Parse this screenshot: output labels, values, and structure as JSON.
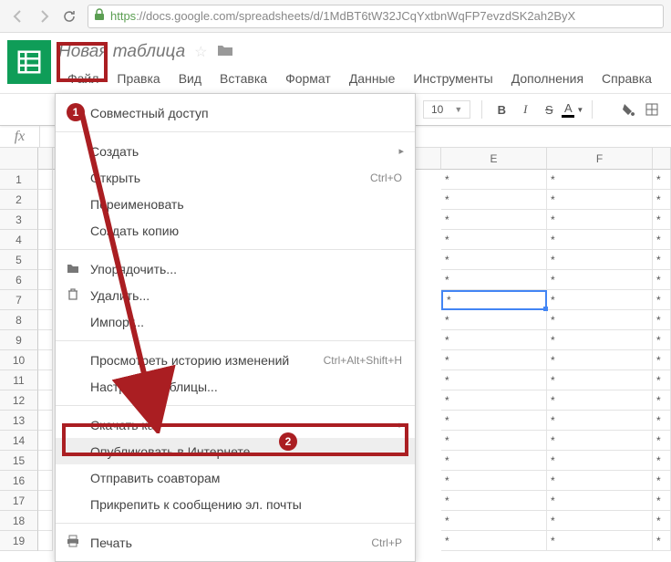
{
  "browser": {
    "url_scheme": "https",
    "url_host_path": "://docs.google.com/spreadsheets/d/1MdBT6tW32JCqYxtbnWqFP7evzdSK2ah2ByX"
  },
  "doc": {
    "title": "Новая таблица"
  },
  "menu": {
    "file": "Файл",
    "edit": "Правка",
    "view": "Вид",
    "insert": "Вставка",
    "format": "Формат",
    "data": "Данные",
    "tools": "Инструменты",
    "addons": "Дополнения",
    "help": "Справка"
  },
  "toolbar": {
    "font_size": "10",
    "bold": "B",
    "italic": "I",
    "strike": "S",
    "color": "A"
  },
  "formula": {
    "fx": "fx"
  },
  "columns": {
    "E": "E",
    "F": "F"
  },
  "rows": [
    "1",
    "2",
    "3",
    "4",
    "5",
    "6",
    "7",
    "8",
    "9",
    "10",
    "11",
    "12",
    "13",
    "14",
    "15",
    "16",
    "17",
    "18",
    "19"
  ],
  "cell_value": "*",
  "file_menu": {
    "share": "Совместный доступ",
    "new": "Создать",
    "open": "Открыть",
    "open_shortcut": "Ctrl+O",
    "rename": "Переименовать",
    "make_copy": "Создать копию",
    "organize": "Упорядочить...",
    "delete": "Удалить...",
    "import": "Импорт...",
    "revision": "Просмотреть историю изменений",
    "revision_shortcut": "Ctrl+Alt+Shift+H",
    "settings": "Настройки таблицы...",
    "download": "Скачать как",
    "publish": "Опубликовать в Интернете...",
    "email_collab": "Отправить соавторам",
    "attach_email": "Прикрепить к сообщению эл. почты",
    "print": "Печать",
    "print_shortcut": "Ctrl+P"
  },
  "badges": {
    "one": "1",
    "two": "2"
  }
}
